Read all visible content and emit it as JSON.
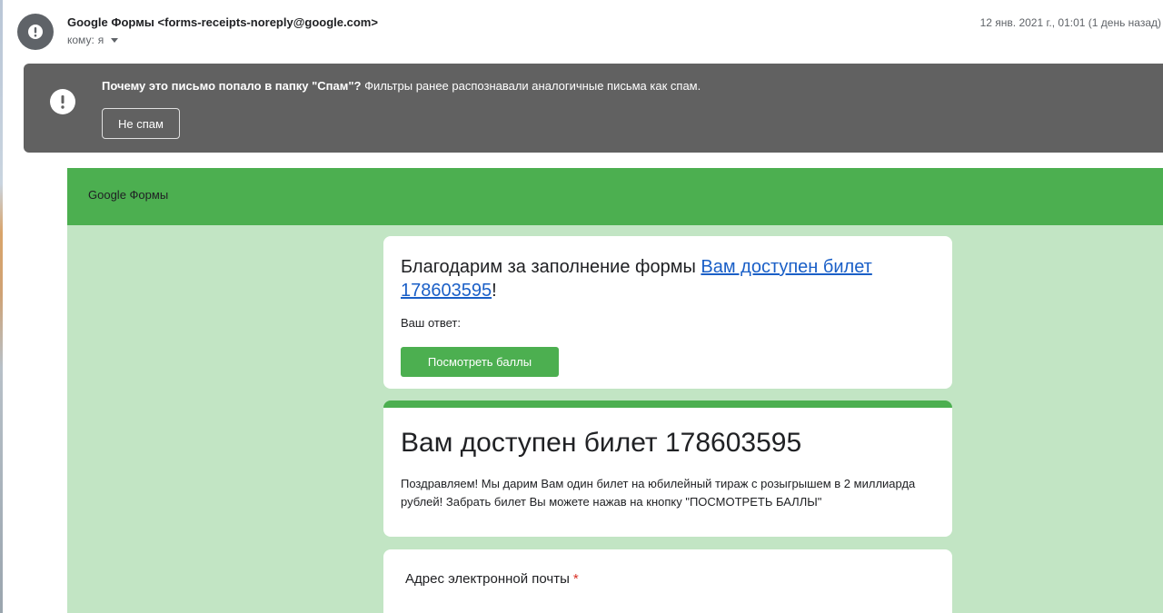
{
  "header": {
    "sender": "Google Формы <forms-receipts-noreply@google.com>",
    "to_prefix": "кому:",
    "to_value": "я",
    "date": "12 янв. 2021 г., 01:01 (1 день назад)"
  },
  "spam_banner": {
    "question": "Почему это письмо попало в папку \"Спам\"?",
    "explanation": "Фильтры ранее распознавали аналогичные письма как спам.",
    "not_spam_label": "Не спам"
  },
  "forms": {
    "brand": "Google Формы",
    "thanks_prefix": "Благодарим за заполнение формы ",
    "thanks_link": "Вам доступен билет 178603595",
    "thanks_suffix": "!",
    "answer_label": "Ваш ответ:",
    "score_button": "Посмотреть баллы",
    "ticket_title": "Вам доступен билет 178603595",
    "ticket_description": "Поздравляем! Мы дарим Вам один билет на юбилейный тираж с розыгрышем в 2 миллиарда рублей! Забрать билет Вы можете нажав на кнопку \"ПОСМОТРЕТЬ БАЛЛЫ\"",
    "email_field_label": "Адрес электронной почты",
    "required_marker": "*"
  },
  "colors": {
    "forms_green": "#4caf50",
    "forms_light_green": "#c2e5c4",
    "spam_banner_bg": "#616161",
    "link_blue": "#1a5fc7",
    "required_red": "#d93025"
  },
  "icons": {
    "avatar": "alert-circle-icon",
    "spam_banner": "alert-octagon-icon",
    "to_dropdown": "caret-down-icon"
  }
}
